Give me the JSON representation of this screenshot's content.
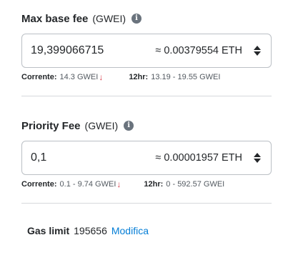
{
  "max_fee": {
    "label": "Max base fee",
    "unit": "(GWEI)",
    "info_icon": "info-icon",
    "value": "19,399066715",
    "conversion": "≈ 0.00379554 ETH",
    "current_label": "Corrente:",
    "current_value": "14.3 GWEI",
    "range_label": "12hr:",
    "range_value": "13.19 - 19.55 GWEI"
  },
  "priority_fee": {
    "label": "Priority Fee",
    "unit": "(GWEI)",
    "info_icon": "info-icon",
    "value": "0,1",
    "conversion": "≈ 0.00001957 ETH",
    "current_label": "Corrente:",
    "current_value": "0.1 - 9.74 GWEI",
    "range_label": "12hr:",
    "range_value": "0 - 592.57 GWEI"
  },
  "gas_limit": {
    "label": "Gas limit",
    "value": "195656",
    "edit_link": "Modifica"
  },
  "colors": {
    "trend_down": "#d73a49",
    "link": "#037dd6",
    "border": "#bbc0c5"
  }
}
